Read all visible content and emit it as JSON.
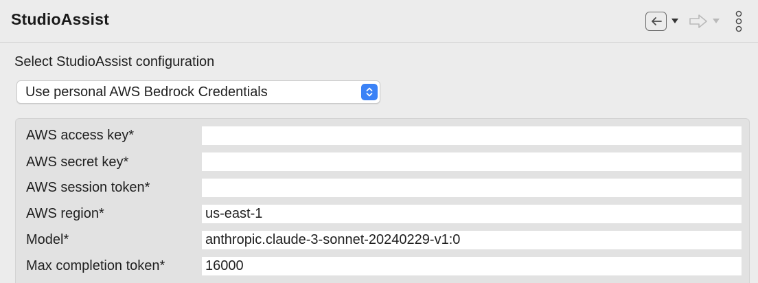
{
  "header": {
    "title": "StudioAssist",
    "back_icon": "back-arrow-icon",
    "forward_icon": "forward-arrow-icon",
    "menu_icon": "more-vertical-icon"
  },
  "config": {
    "label": "Select StudioAssist configuration",
    "selected_option": "Use personal AWS Bedrock Credentials",
    "stepper_color": "#3b82f6"
  },
  "fields": [
    {
      "label": "AWS access key*",
      "value": ""
    },
    {
      "label": "AWS secret key*",
      "value": ""
    },
    {
      "label": "AWS session token*",
      "value": ""
    },
    {
      "label": "AWS region*",
      "value": "us-east-1"
    },
    {
      "label": "Model*",
      "value": "anthropic.claude-3-sonnet-20240229-v1:0"
    },
    {
      "label": "Max completion token*",
      "value": "16000"
    }
  ]
}
